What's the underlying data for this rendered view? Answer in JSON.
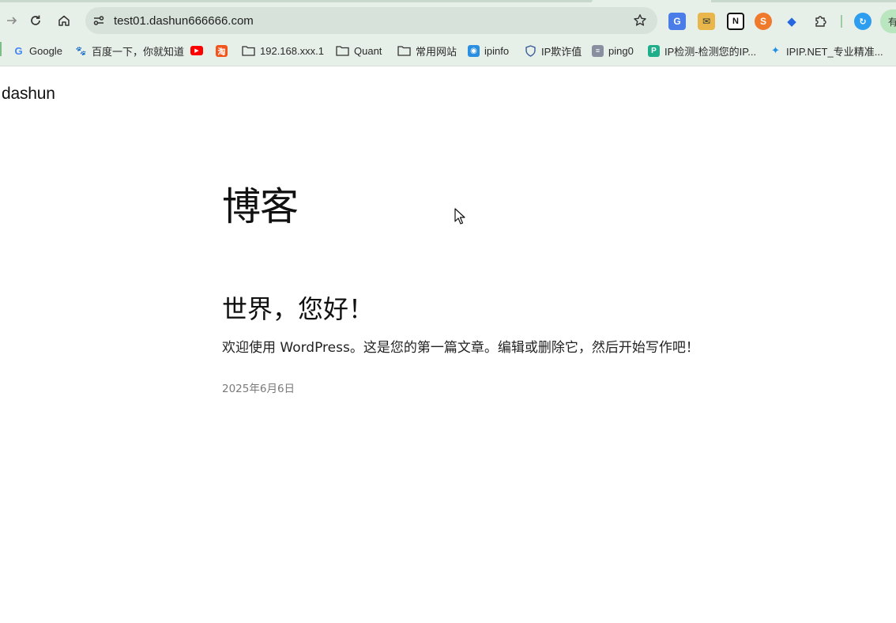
{
  "browser": {
    "url": "test01.dashun666666.com",
    "profile_label": "有"
  },
  "bookmarks": [
    {
      "label": "Google",
      "icon": "google-icon"
    },
    {
      "label": "百度一下，你就知道",
      "icon": "baidu-icon"
    },
    {
      "label": "",
      "icon": "youtube-icon"
    },
    {
      "label": "",
      "icon": "taobao-icon"
    },
    {
      "label": "192.168.xxx.1",
      "icon": "folder-icon"
    },
    {
      "label": "Quant",
      "icon": "folder-icon"
    },
    {
      "label": "常用网站",
      "icon": "folder-icon"
    },
    {
      "label": "ipinfo",
      "icon": "ipinfo-icon"
    },
    {
      "label": "IP欺诈值",
      "icon": "shield-icon"
    },
    {
      "label": "ping0",
      "icon": "server-icon"
    },
    {
      "label": "IP检测-检测您的IP...",
      "icon": "ipcheck-icon"
    },
    {
      "label": "IPIP.NET_专业精准...",
      "icon": "ipip-icon"
    }
  ],
  "site": {
    "title": "dashun"
  },
  "main": {
    "heading": "博客",
    "post": {
      "title": "世界，您好！",
      "excerpt": "欢迎使用 WordPress。这是您的第一篇文章。编辑或删除它，然后开始写作吧！",
      "date": "2025年6月6日"
    }
  },
  "colors": {
    "chrome_bg": "#e7efe9",
    "omnibox_bg": "#d7e2da",
    "text": "#111111",
    "date_text": "#7a7a7a"
  }
}
